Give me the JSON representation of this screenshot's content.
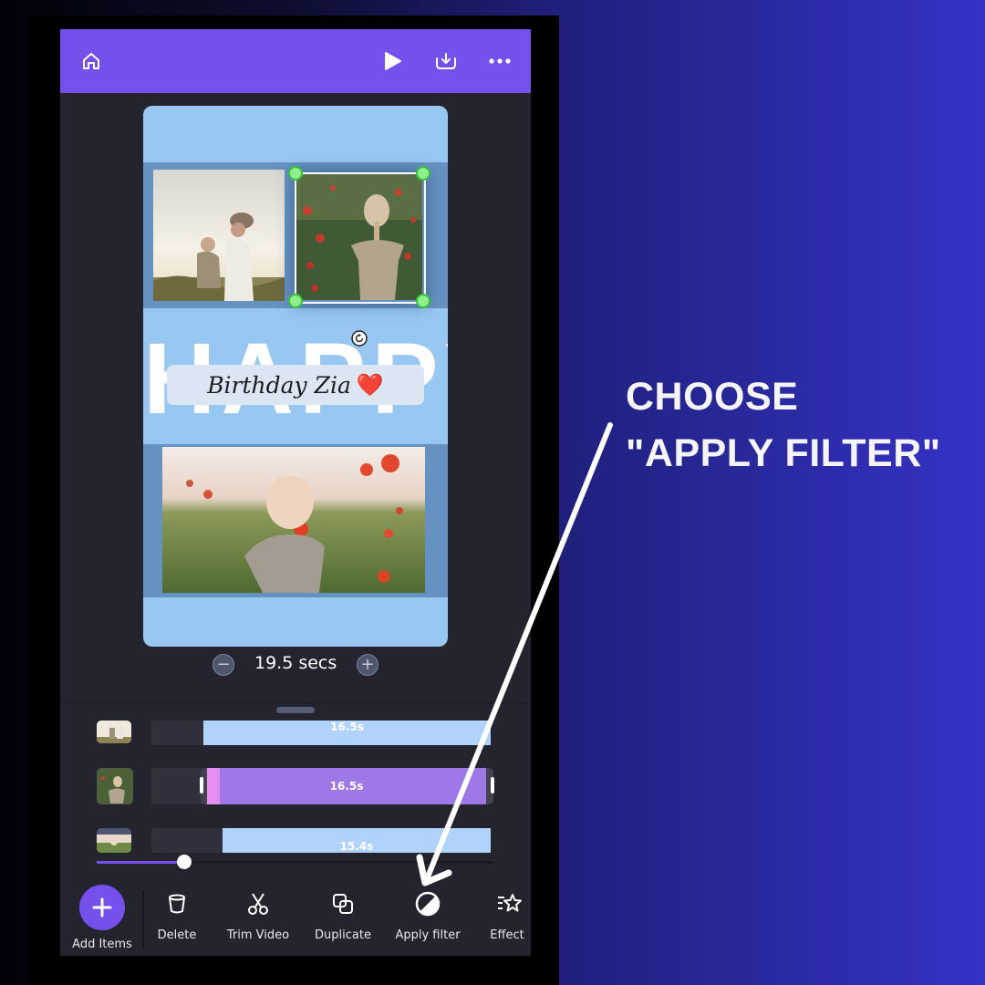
{
  "top_bar": {
    "icons": [
      "home-icon",
      "play-icon",
      "download-icon",
      "more-options-icon"
    ],
    "color": "#7650ec"
  },
  "canvas": {
    "happy_text": "HAPPY",
    "caption": "Birthday Zia",
    "caption_emoji": "❤️",
    "photos": [
      {
        "name": "mother-and-baby-photo",
        "selected": false
      },
      {
        "name": "girl-in-poppies-back-photo",
        "selected": true
      },
      {
        "name": "toddler-in-poppy-field-photo",
        "selected": false
      }
    ],
    "background_color": "#98c7f2"
  },
  "duration": {
    "value": "19.5 secs",
    "decrease_symbol": "−",
    "increase_symbol": "+"
  },
  "timeline": {
    "tracks": [
      {
        "label": "16.5s",
        "selected": false,
        "color": "#b1d3fb"
      },
      {
        "label": "16.5s",
        "selected": true,
        "color": "#9d78e6",
        "accent": "#e38ef0"
      },
      {
        "label": "15.4s",
        "selected": false,
        "color": "#b1d3fb"
      }
    ],
    "scrub_progress": 0.22
  },
  "toolbar": {
    "items": [
      {
        "label": "Add Items",
        "icon": "plus-icon"
      },
      {
        "label": "Delete",
        "icon": "trash-icon"
      },
      {
        "label": "Trim Video",
        "icon": "scissors-icon"
      },
      {
        "label": "Duplicate",
        "icon": "duplicate-icon"
      },
      {
        "label": "Apply filter",
        "icon": "filter-icon"
      },
      {
        "label": "Effect",
        "icon": "effect-star-icon"
      }
    ]
  },
  "annotation": {
    "line1": "CHOOSE",
    "line2": "\"APPLY FILTER\""
  }
}
